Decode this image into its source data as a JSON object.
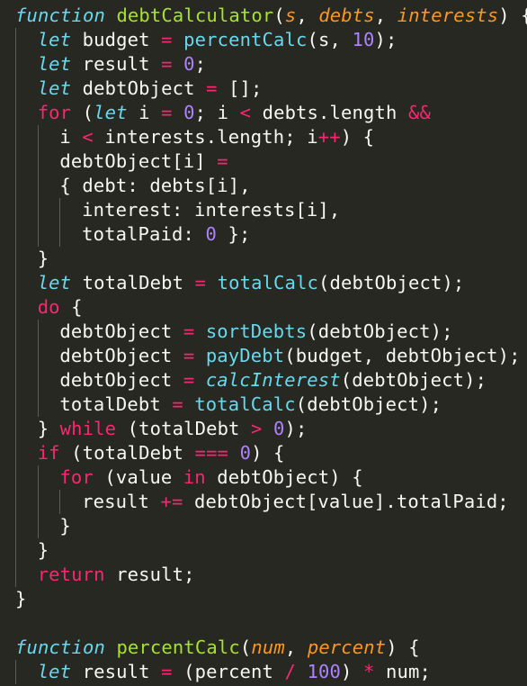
{
  "editor": {
    "colors": {
      "background": "#272822",
      "plain": "#f8f8f2",
      "keyword": "#f92672",
      "storage": "#66d9ef",
      "function": "#a6e22e",
      "parameter": "#fd971f",
      "number": "#ae81ff",
      "indent_guide": "#5a5b52"
    },
    "lines": [
      {
        "indent": 0,
        "tokens": [
          [
            "function",
            "storage-italic"
          ],
          [
            " ",
            "plain"
          ],
          [
            "debtCalculator",
            "function"
          ],
          [
            "(",
            "plain"
          ],
          [
            "s",
            "parameter"
          ],
          [
            ", ",
            "plain"
          ],
          [
            "debts",
            "parameter"
          ],
          [
            ", ",
            "plain"
          ],
          [
            "interests",
            "parameter"
          ],
          [
            ") {",
            "plain"
          ]
        ]
      },
      {
        "indent": 1,
        "tokens": [
          [
            "let",
            "storage-italic"
          ],
          [
            " budget ",
            "plain"
          ],
          [
            "=",
            "keyword"
          ],
          [
            " ",
            "plain"
          ],
          [
            "percentCalc",
            "storage"
          ],
          [
            "(s, ",
            "plain"
          ],
          [
            "10",
            "number"
          ],
          [
            ");",
            "plain"
          ]
        ]
      },
      {
        "indent": 1,
        "tokens": [
          [
            "let",
            "storage-italic"
          ],
          [
            " result ",
            "plain"
          ],
          [
            "=",
            "keyword"
          ],
          [
            " ",
            "plain"
          ],
          [
            "0",
            "number"
          ],
          [
            ";",
            "plain"
          ]
        ]
      },
      {
        "indent": 1,
        "tokens": [
          [
            "let",
            "storage-italic"
          ],
          [
            " debtObject ",
            "plain"
          ],
          [
            "=",
            "keyword"
          ],
          [
            " [];",
            "plain"
          ]
        ]
      },
      {
        "indent": 1,
        "tokens": [
          [
            "for",
            "keyword"
          ],
          [
            " (",
            "plain"
          ],
          [
            "let",
            "storage-italic"
          ],
          [
            " i ",
            "plain"
          ],
          [
            "=",
            "keyword"
          ],
          [
            " ",
            "plain"
          ],
          [
            "0",
            "number"
          ],
          [
            "; i ",
            "plain"
          ],
          [
            "<",
            "keyword"
          ],
          [
            " debts.length ",
            "plain"
          ],
          [
            "&&",
            "keyword"
          ]
        ]
      },
      {
        "indent": 2,
        "tokens": [
          [
            "i ",
            "plain"
          ],
          [
            "<",
            "keyword"
          ],
          [
            " interests.length; i",
            "plain"
          ],
          [
            "++",
            "keyword"
          ],
          [
            ") {",
            "plain"
          ]
        ]
      },
      {
        "indent": 2,
        "tokens": [
          [
            "debtObject[i] ",
            "plain"
          ],
          [
            "=",
            "keyword"
          ]
        ]
      },
      {
        "indent": 2,
        "tokens": [
          [
            "{ debt: debts[i],",
            "plain"
          ]
        ]
      },
      {
        "indent": 3,
        "tokens": [
          [
            "interest: interests[i],",
            "plain"
          ]
        ]
      },
      {
        "indent": 3,
        "tokens": [
          [
            "totalPaid: ",
            "plain"
          ],
          [
            "0",
            "number"
          ],
          [
            " };",
            "plain"
          ]
        ]
      },
      {
        "indent": 1,
        "tokens": [
          [
            "}",
            "plain"
          ]
        ]
      },
      {
        "indent": 1,
        "tokens": [
          [
            "let",
            "storage-italic"
          ],
          [
            " totalDebt ",
            "plain"
          ],
          [
            "=",
            "keyword"
          ],
          [
            " ",
            "plain"
          ],
          [
            "totalCalc",
            "storage"
          ],
          [
            "(debtObject);",
            "plain"
          ]
        ]
      },
      {
        "indent": 1,
        "tokens": [
          [
            "do",
            "keyword"
          ],
          [
            " {",
            "plain"
          ]
        ]
      },
      {
        "indent": 2,
        "tokens": [
          [
            "debtObject ",
            "plain"
          ],
          [
            "=",
            "keyword"
          ],
          [
            " ",
            "plain"
          ],
          [
            "sortDebts",
            "storage"
          ],
          [
            "(debtObject);",
            "plain"
          ]
        ]
      },
      {
        "indent": 2,
        "tokens": [
          [
            "debtObject ",
            "plain"
          ],
          [
            "=",
            "keyword"
          ],
          [
            " ",
            "plain"
          ],
          [
            "payDebt",
            "storage"
          ],
          [
            "(budget, debtObject);",
            "plain"
          ]
        ]
      },
      {
        "indent": 2,
        "tokens": [
          [
            "debtObject ",
            "plain"
          ],
          [
            "=",
            "keyword"
          ],
          [
            " ",
            "plain"
          ],
          [
            "calcInterest",
            "storage-italic"
          ],
          [
            "(debtObject);",
            "plain"
          ]
        ]
      },
      {
        "indent": 2,
        "tokens": [
          [
            "totalDebt ",
            "plain"
          ],
          [
            "=",
            "keyword"
          ],
          [
            " ",
            "plain"
          ],
          [
            "totalCalc",
            "storage"
          ],
          [
            "(debtObject);",
            "plain"
          ]
        ]
      },
      {
        "indent": 1,
        "tokens": [
          [
            "} ",
            "plain"
          ],
          [
            "while",
            "keyword"
          ],
          [
            " (totalDebt ",
            "plain"
          ],
          [
            ">",
            "keyword"
          ],
          [
            " ",
            "plain"
          ],
          [
            "0",
            "number"
          ],
          [
            ");",
            "plain"
          ]
        ]
      },
      {
        "indent": 1,
        "tokens": [
          [
            "if",
            "keyword"
          ],
          [
            " (totalDebt ",
            "plain"
          ],
          [
            "===",
            "keyword"
          ],
          [
            " ",
            "plain"
          ],
          [
            "0",
            "number"
          ],
          [
            ") {",
            "plain"
          ]
        ]
      },
      {
        "indent": 2,
        "tokens": [
          [
            "for",
            "keyword"
          ],
          [
            " (value ",
            "plain"
          ],
          [
            "in",
            "keyword"
          ],
          [
            " debtObject) {",
            "plain"
          ]
        ]
      },
      {
        "indent": 3,
        "tokens": [
          [
            "result ",
            "plain"
          ],
          [
            "+=",
            "keyword"
          ],
          [
            " debtObject[value].totalPaid;",
            "plain"
          ]
        ]
      },
      {
        "indent": 2,
        "tokens": [
          [
            "}",
            "plain"
          ]
        ]
      },
      {
        "indent": 1,
        "tokens": [
          [
            "}",
            "plain"
          ]
        ]
      },
      {
        "indent": 1,
        "tokens": [
          [
            "return",
            "keyword"
          ],
          [
            " result;",
            "plain"
          ]
        ]
      },
      {
        "indent": 0,
        "tokens": [
          [
            "}",
            "plain"
          ]
        ]
      },
      {
        "indent": 0,
        "tokens": []
      },
      {
        "indent": 0,
        "tokens": [
          [
            "function",
            "storage-italic"
          ],
          [
            " ",
            "plain"
          ],
          [
            "percentCalc",
            "function"
          ],
          [
            "(",
            "plain"
          ],
          [
            "num",
            "parameter"
          ],
          [
            ", ",
            "plain"
          ],
          [
            "percent",
            "parameter"
          ],
          [
            ") {",
            "plain"
          ]
        ]
      },
      {
        "indent": 1,
        "tokens": [
          [
            "let",
            "storage-italic"
          ],
          [
            " result ",
            "plain"
          ],
          [
            "=",
            "keyword"
          ],
          [
            " (percent ",
            "plain"
          ],
          [
            "/",
            "keyword"
          ],
          [
            " ",
            "plain"
          ],
          [
            "100",
            "number"
          ],
          [
            ") ",
            "plain"
          ],
          [
            "*",
            "keyword"
          ],
          [
            " num;",
            "plain"
          ]
        ]
      }
    ]
  }
}
